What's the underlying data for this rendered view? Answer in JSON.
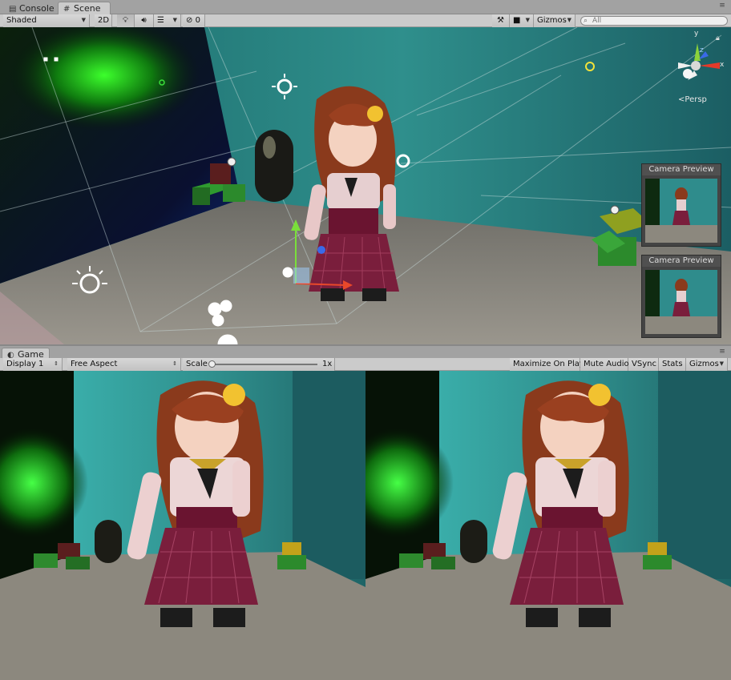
{
  "scene_panel": {
    "tabs": [
      {
        "label": "Console",
        "icon": "console-icon",
        "active": false
      },
      {
        "label": "Scene",
        "icon": "scene-grid-icon",
        "active": true
      }
    ],
    "toolbar": {
      "draw_mode": "Shaded",
      "mode_2d": "2D",
      "hidden_count": "0",
      "gizmos": "Gizmos",
      "search_placeholder": "All"
    },
    "view_label": "Persp",
    "gizmo_axes": {
      "y": "y",
      "x": "x",
      "z": "z"
    },
    "camera_previews": [
      {
        "title": "Camera Preview"
      },
      {
        "title": "Camera Preview"
      }
    ]
  },
  "game_panel": {
    "tab": {
      "label": "Game",
      "icon": "game-icon"
    },
    "toolbar": {
      "display": "Display 1",
      "aspect": "Free Aspect",
      "scale_label": "Scale",
      "scale_value": "1x",
      "scale_level": 0.0,
      "maximize_on_play": "Maximize On Play",
      "mute_audio": "Mute Audio",
      "vsync": "VSync",
      "stats": "Stats",
      "gizmos": "Gizmos"
    }
  },
  "colors": {
    "editor_bg": "#a2a2a2",
    "toolbar_bg": "#cbcbcb",
    "wall_teal": "#2a8a8a",
    "floor_gray": "#8e8a80",
    "green_light": "#1fd21f",
    "skirt_plum": "#7a1e3c",
    "hair_brown": "#8a3a1c"
  }
}
